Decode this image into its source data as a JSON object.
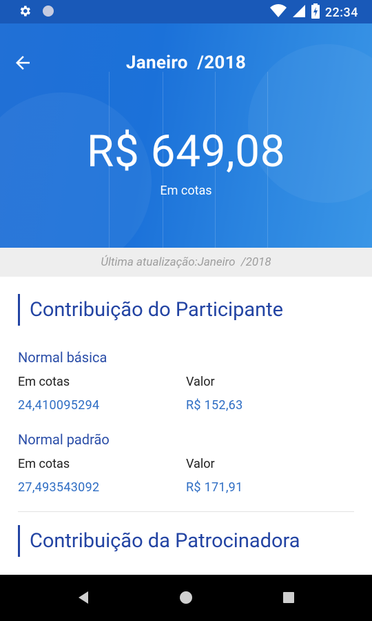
{
  "status_bar": {
    "time": "22:34",
    "icons": [
      "gear-icon",
      "circle-icon",
      "wifi-icon",
      "signal-icon",
      "battery-charging-icon"
    ]
  },
  "header": {
    "title": "Janeiro  /2018",
    "amount": "R$ 649,08",
    "amount_unit": "Em cotas"
  },
  "update_note": "Última atualização:Janeiro  /2018",
  "participant": {
    "title": "Contribuição do Participante",
    "groups": [
      {
        "name": "Normal básica",
        "cotas_label": "Em cotas",
        "cotas_value": "24,410095294",
        "valor_label": "Valor",
        "valor_value": "R$ 152,63"
      },
      {
        "name": "Normal padrão",
        "cotas_label": "Em cotas",
        "cotas_value": "27,493543092",
        "valor_label": "Valor",
        "valor_value": "R$ 171,91"
      }
    ]
  },
  "sponsor": {
    "title": "Contribuição da Patrocinadora"
  },
  "colors": {
    "accent": "#2344a3",
    "value_blue": "#2f6ec4",
    "hero_blue": "#1b71d9",
    "status_blue": "#1959b8"
  }
}
